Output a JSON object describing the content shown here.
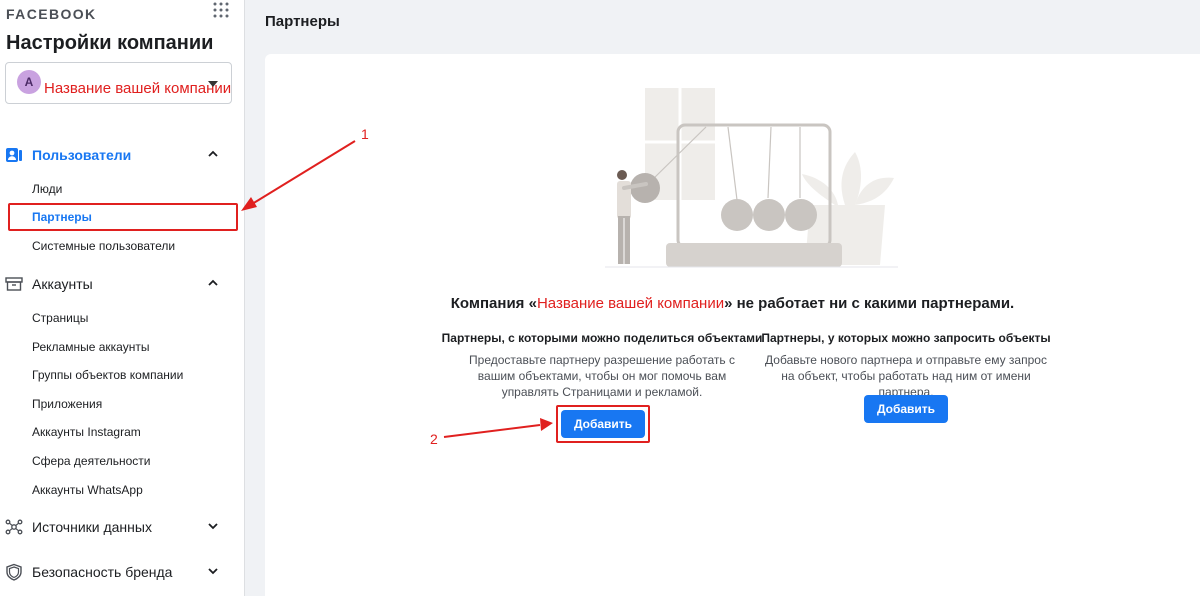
{
  "sidebar": {
    "brand": "FACEBOOK",
    "title": "Настройки компании",
    "company_select": {
      "avatar_letter": "A",
      "value": "Название вашей компании"
    },
    "sections": [
      {
        "label": "Пользователи",
        "icon": "users-icon",
        "expanded": true,
        "active": true,
        "items": [
          {
            "label": "Люди"
          },
          {
            "label": "Партнеры",
            "active": true
          },
          {
            "label": "Системные пользователи"
          }
        ]
      },
      {
        "label": "Аккаунты",
        "icon": "accounts-icon",
        "expanded": true,
        "items": [
          {
            "label": "Страницы"
          },
          {
            "label": "Рекламные аккаунты"
          },
          {
            "label": "Группы объектов компании"
          },
          {
            "label": "Приложения"
          },
          {
            "label": "Аккаунты Instagram"
          },
          {
            "label": "Сфера деятельности"
          },
          {
            "label": "Аккаунты WhatsApp"
          }
        ]
      },
      {
        "label": "Источники данных",
        "icon": "data-sources-icon",
        "expanded": false
      },
      {
        "label": "Безопасность бренда",
        "icon": "shield-icon",
        "expanded": false
      }
    ]
  },
  "main": {
    "title": "Партнеры",
    "empty_message": {
      "prefix": "Компания «",
      "company": "Название вашей компании",
      "suffix": "» не работает ни с какими партнерами."
    },
    "share_column": {
      "title": "Партнеры, с которыми можно поделиться объектами",
      "description": "Предоставьте партнеру разрешение работать с вашим объектами, чтобы он мог помочь вам управлять Страницами и рекламой.",
      "button": "Добавить"
    },
    "request_column": {
      "title": "Партнеры, у которых можно запросить объекты",
      "description": "Добавьте нового партнера и отправьте ему запрос на объект, чтобы работать над ним от имени партнера.",
      "button": "Добавить"
    }
  },
  "annotations": {
    "step1": "1",
    "step2": "2"
  },
  "colors": {
    "accent": "#1877f2",
    "annotation": "#e0201f"
  }
}
